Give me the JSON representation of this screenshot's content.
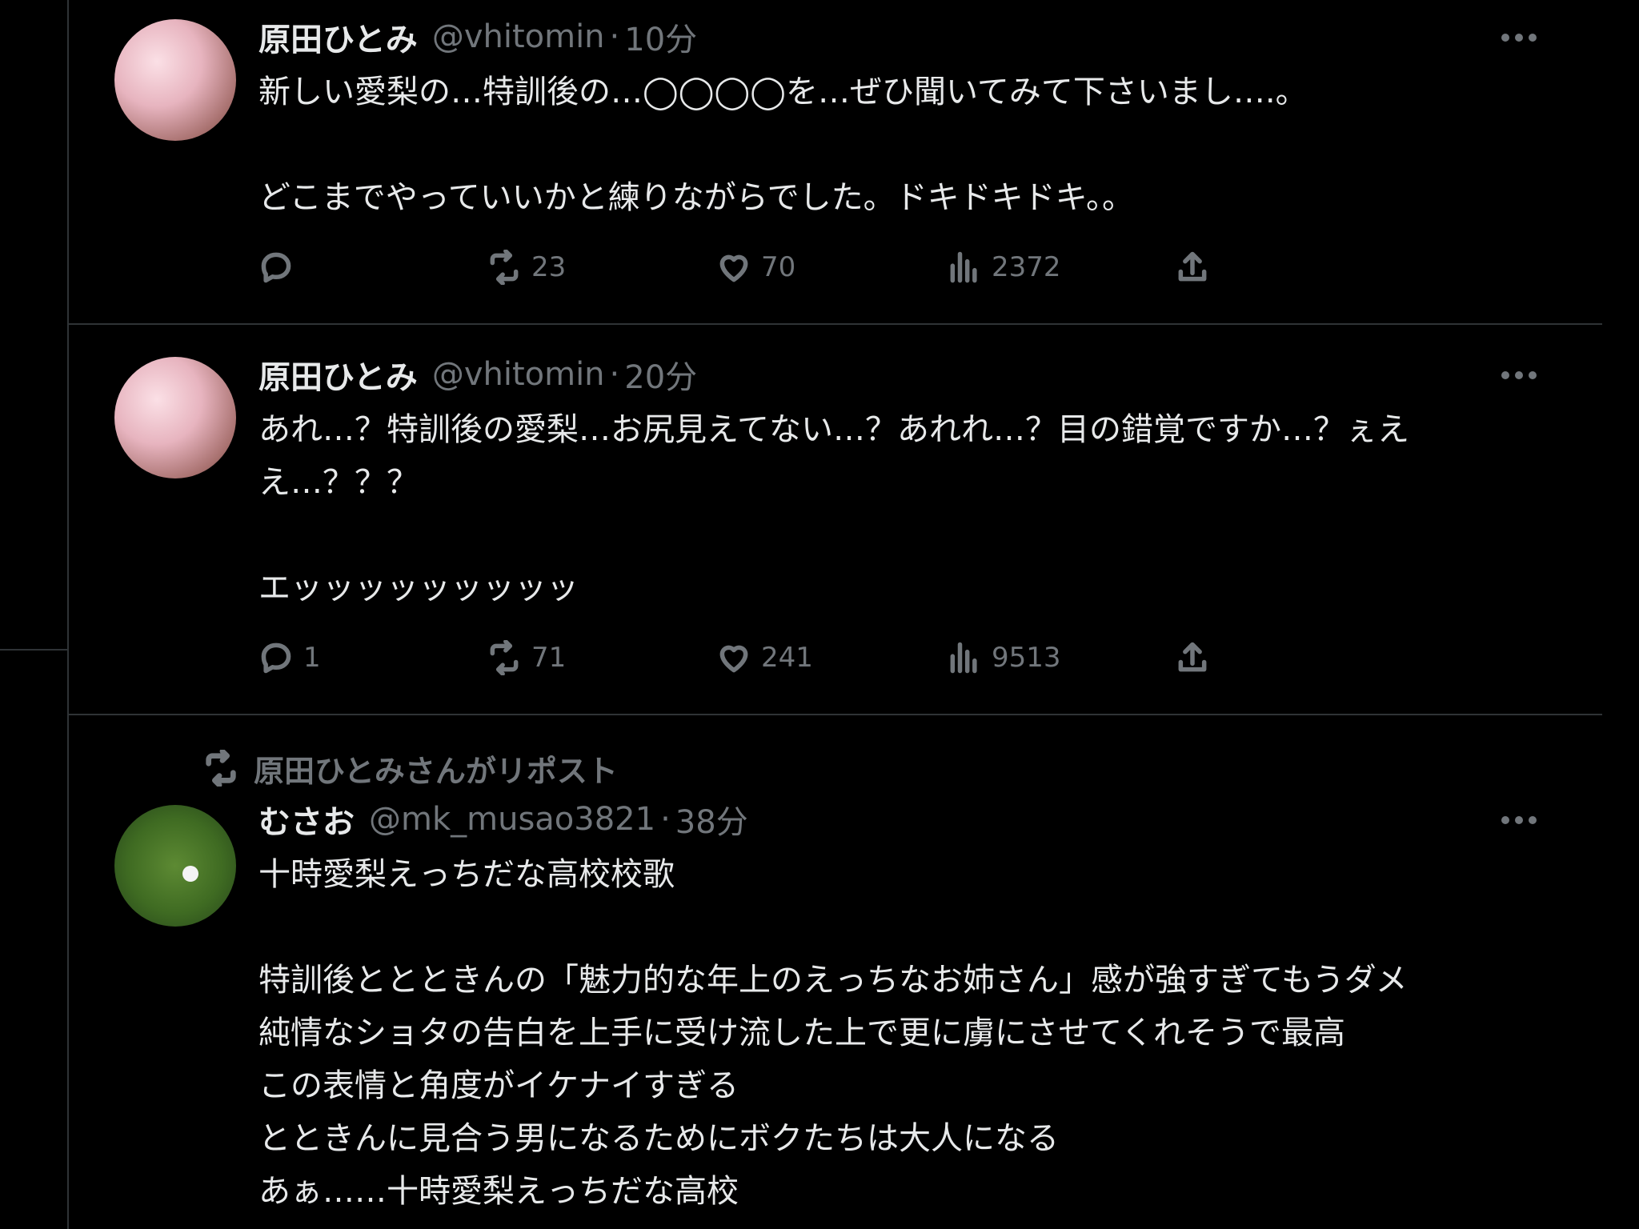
{
  "tweets": [
    {
      "name": "原田ひとみ",
      "handle": "@vhitomin",
      "sep": "·",
      "time": "10分",
      "lines": [
        "新しい愛梨の…特訓後の…◯◯◯◯を…ぜひ聞いてみて下さいまし….。",
        "",
        "どこまでやっていいかと練りながらでした。ドキドキドキ。。"
      ],
      "replies": "",
      "reposts": "23",
      "likes": "70",
      "views": "2372"
    },
    {
      "name": "原田ひとみ",
      "handle": "@vhitomin",
      "sep": "·",
      "time": "20分",
      "lines": [
        "あれ…？特訓後の愛梨…お尻見えてない…？あれれ…？目の錯覚ですか…？ぇえ",
        "え…？？？",
        "",
        "エッッッッッッッッッ"
      ],
      "replies": "1",
      "reposts": "71",
      "likes": "241",
      "views": "9513"
    },
    {
      "repost_label": "原田ひとみさんがリポスト",
      "name": "むさお",
      "handle": "@mk_musao3821",
      "sep": "·",
      "time": "38分",
      "lines": [
        "十時愛梨えっちだな高校校歌",
        "",
        "特訓後ととときんの「魅力的な年上のえっちなお姉さん」感が強すぎてもうダメ",
        "純情なショタの告白を上手に受け流した上で更に虜にさせてくれそうで最高",
        "この表情と角度がイケナイすぎる",
        "とときんに見合う男になるためにボクたちは大人になる",
        "あぁ……十時愛梨えっちだな高校"
      ]
    }
  ],
  "icons": {
    "reply": "reply-icon",
    "repost": "repost-icon",
    "like": "heart-icon",
    "views": "views-icon",
    "share": "share-icon",
    "more": "more-icon"
  },
  "colors": {
    "background": "#000000",
    "text": "#e7e9ea",
    "secondary": "#71767b",
    "divider": "#2f3336"
  }
}
